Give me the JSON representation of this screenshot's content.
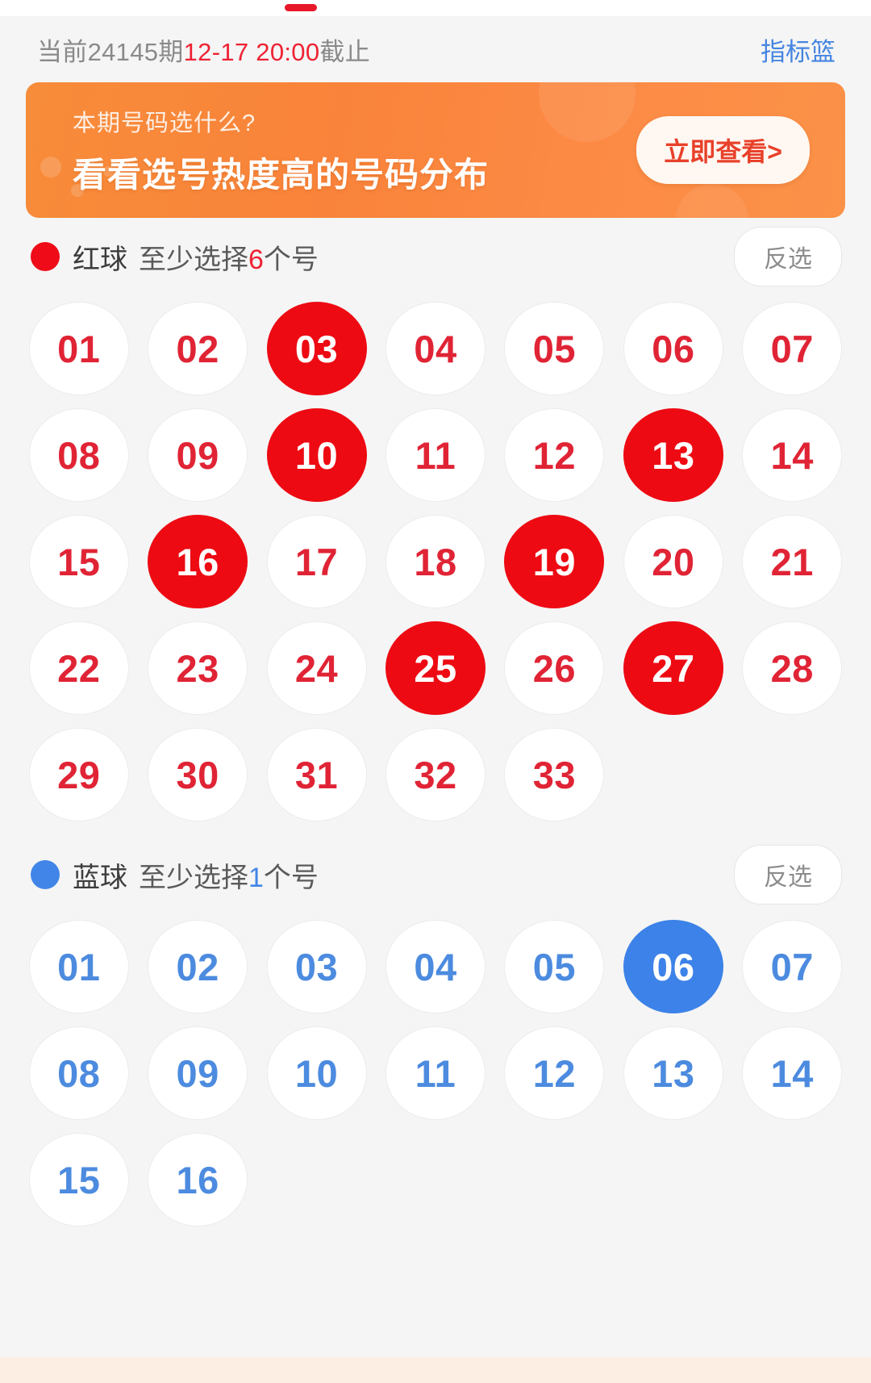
{
  "header": {
    "issue_text": "当前24145期",
    "deadline_time": "12-17 20:00",
    "deadline_suffix": "截止",
    "basket_label": "指标篮"
  },
  "banner": {
    "subtitle": "本期号码选什么?",
    "title": "看看选号热度高的号码分布",
    "cta_label": "立即查看>"
  },
  "red_section": {
    "label": "红球",
    "rule_prefix": "至少选择",
    "rule_count": "6",
    "rule_suffix": "个号",
    "invert_label": "反选",
    "dot_color": "#ef0b18",
    "selected_color": "#ed0a13",
    "number_color": "#e02435",
    "numbers": [
      "01",
      "02",
      "03",
      "04",
      "05",
      "06",
      "07",
      "08",
      "09",
      "10",
      "11",
      "12",
      "13",
      "14",
      "15",
      "16",
      "17",
      "18",
      "19",
      "20",
      "21",
      "22",
      "23",
      "24",
      "25",
      "26",
      "27",
      "28",
      "29",
      "30",
      "31",
      "32",
      "33"
    ],
    "selected": [
      "03",
      "10",
      "13",
      "16",
      "19",
      "25",
      "27"
    ]
  },
  "blue_section": {
    "label": "蓝球",
    "rule_prefix": "至少选择",
    "rule_count": "1",
    "rule_suffix": "个号",
    "invert_label": "反选",
    "dot_color": "#4285e8",
    "selected_color": "#3c82e8",
    "number_color": "#4c8bdf",
    "numbers": [
      "01",
      "02",
      "03",
      "04",
      "05",
      "06",
      "07",
      "08",
      "09",
      "10",
      "11",
      "12",
      "13",
      "14",
      "15",
      "16"
    ],
    "selected": [
      "06"
    ]
  }
}
